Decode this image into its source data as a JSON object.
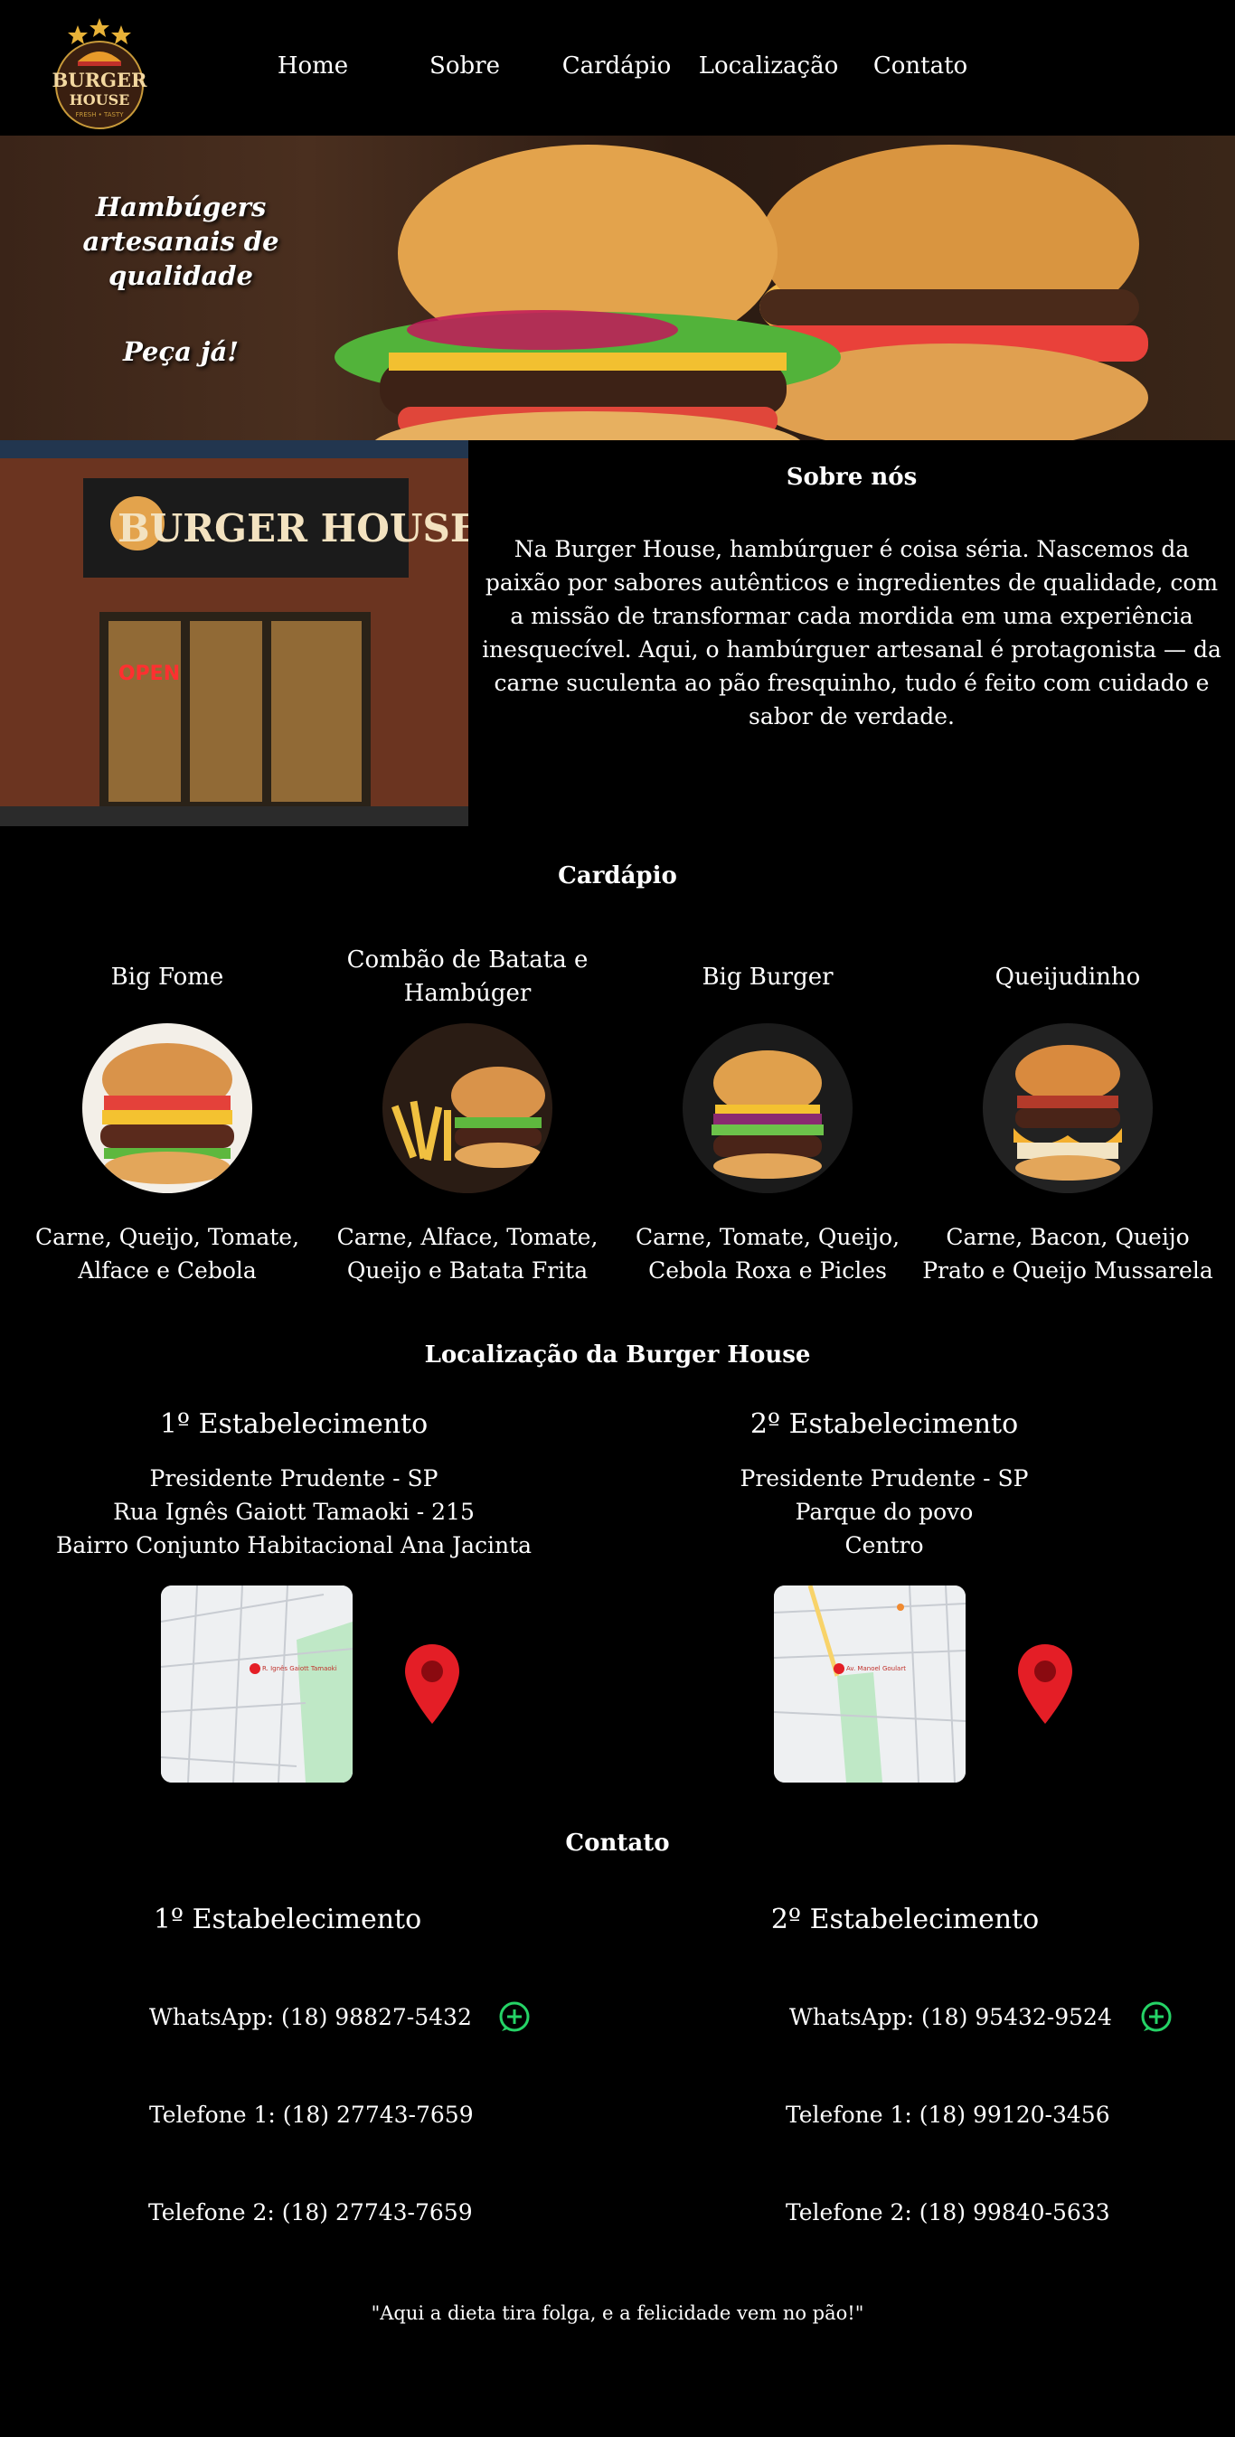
{
  "nav": {
    "logo_top": "BURGER",
    "logo_bottom": "HOUSE",
    "logo_tagline": "FRESH • TASTY",
    "links": [
      "Home",
      "Sobre",
      "Cardápio",
      "Localização",
      "Contato"
    ]
  },
  "hero": {
    "tagline": "Hambúgers artesanais de qualidade",
    "cta": "Peça já!"
  },
  "about": {
    "sign_text": "BURGER HOUSE",
    "open_sign": "OPEN",
    "title": "Sobre nós",
    "body": "Na Burger House, hambúrguer é coisa séria. Nascemos da paixão por sabores autênticos e ingredientes de qualidade, com a missão de transformar cada mordida em uma experiência inesquecível. Aqui, o hambúrguer artesanal é protagonista — da carne suculenta ao pão fresquinho, tudo é feito com cuidado e sabor de verdade."
  },
  "menu": {
    "title": "Cardápio",
    "items": [
      {
        "name": "Big Fome",
        "desc": "Carne, Queijo,  Tomate, Alface e Cebola"
      },
      {
        "name": "Combão de Batata e Hambúger",
        "desc": "Carne, Alface, Tomate, Queijo e Batata Frita"
      },
      {
        "name": "Big Burger",
        "desc": "Carne, Tomate, Queijo, Cebola Roxa e Picles"
      },
      {
        "name": "Queijudinho",
        "desc": "Carne, Bacon, Queijo Prato e Queijo Mussarela"
      }
    ]
  },
  "location": {
    "title": "Localização da Burger House",
    "stores": [
      {
        "name": "1º Estabelecimento",
        "lines": [
          "Presidente Prudente - SP",
          "Rua Ignês Gaiott Tamaoki - 215",
          "Bairro Conjunto Habitacional Ana Jacinta"
        ],
        "map_label": "R. Ignês Gaiott Tamaoki"
      },
      {
        "name": "2º Estabelecimento",
        "lines": [
          "Presidente Prudente - SP",
          "Parque do povo",
          "Centro"
        ],
        "map_label": "Av. Manoel Goulart"
      }
    ]
  },
  "contact": {
    "title": "Contato",
    "stores": [
      {
        "name": "1º Estabelecimento",
        "whatsapp": "WhatsApp: (18) 98827-5432",
        "phone1": "Telefone 1: (18) 27743-7659",
        "phone2": "Telefone 2: (18) 27743-7659"
      },
      {
        "name": "2º Estabelecimento",
        "whatsapp": "WhatsApp: (18) 95432-9524",
        "phone1": "Telefone 1: (18)  99120-3456",
        "phone2": "Telefone 2: (18) 99840-5633"
      }
    ]
  },
  "footer": {
    "quote": "\"Aqui a dieta tira folga, e a felicidade vem no pão!\""
  },
  "colors": {
    "background": "#000000",
    "whatsapp_green": "#25d366",
    "pin_red": "#e41e26"
  }
}
